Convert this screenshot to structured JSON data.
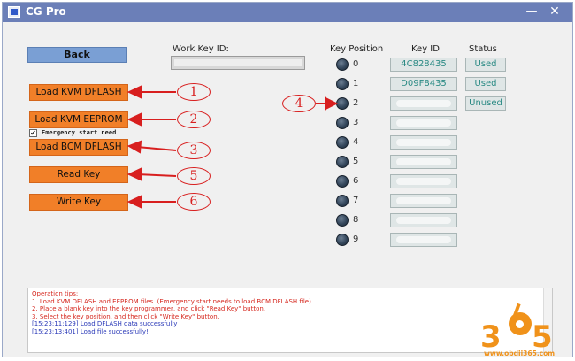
{
  "window": {
    "title": "CG Pro",
    "minimize_glyph": "—",
    "close_glyph": "✕"
  },
  "left_panel": {
    "back_label": "Back",
    "load_kvm_dflash_label": "Load KVM DFLASH",
    "load_kvm_eeprom_label": "Load KVM EEPROM",
    "emergency_label": "Emergency start need",
    "emergency_checked": true,
    "load_bcm_dflash_label": "Load BCM DFLASH",
    "read_key_label": "Read Key",
    "write_key_label": "Write Key"
  },
  "work_key": {
    "label": "Work Key ID:",
    "value": ""
  },
  "key_table": {
    "headers": {
      "position": "Key Position",
      "key_id": "Key ID",
      "status": "Status"
    },
    "rows": [
      {
        "position": "0",
        "key_id": "4C828435",
        "status": "Used"
      },
      {
        "position": "1",
        "key_id": "D09F8435",
        "status": "Used"
      },
      {
        "position": "2",
        "key_id": "",
        "status": "Unused"
      },
      {
        "position": "3",
        "key_id": "",
        "status": ""
      },
      {
        "position": "4",
        "key_id": "",
        "status": ""
      },
      {
        "position": "5",
        "key_id": "",
        "status": ""
      },
      {
        "position": "6",
        "key_id": "",
        "status": ""
      },
      {
        "position": "7",
        "key_id": "",
        "status": ""
      },
      {
        "position": "8",
        "key_id": "",
        "status": ""
      },
      {
        "position": "9",
        "key_id": "",
        "status": ""
      }
    ]
  },
  "annotations": {
    "n1": "1",
    "n2": "2",
    "n3": "3",
    "n4": "4",
    "n5": "5",
    "n6": "6",
    "color": "#d81f1f"
  },
  "log": {
    "lines": [
      "Operation tips:",
      "1. Load KVM DFLASH and EEPROM files. (Emergency start needs to load BCM DFLASH file)",
      "2. Place a blank key into the key programmer, and click \"Read Key\" button.",
      "3. Select the key position, and then click \"Write Key\" button.",
      "[15:23:11:129]  Load DFLASH data successfully",
      "[15:23:13:401]  Load file successfully!"
    ]
  },
  "watermark": {
    "digit_left": "3",
    "digit_right": "5",
    "url": "www.obdii365.com",
    "color": "#f0921a"
  },
  "colors": {
    "titlebar": "#6b7fb8",
    "orange_button": "#f17f28",
    "back_button": "#7a9fd4",
    "teal_text": "#2a8a84"
  }
}
